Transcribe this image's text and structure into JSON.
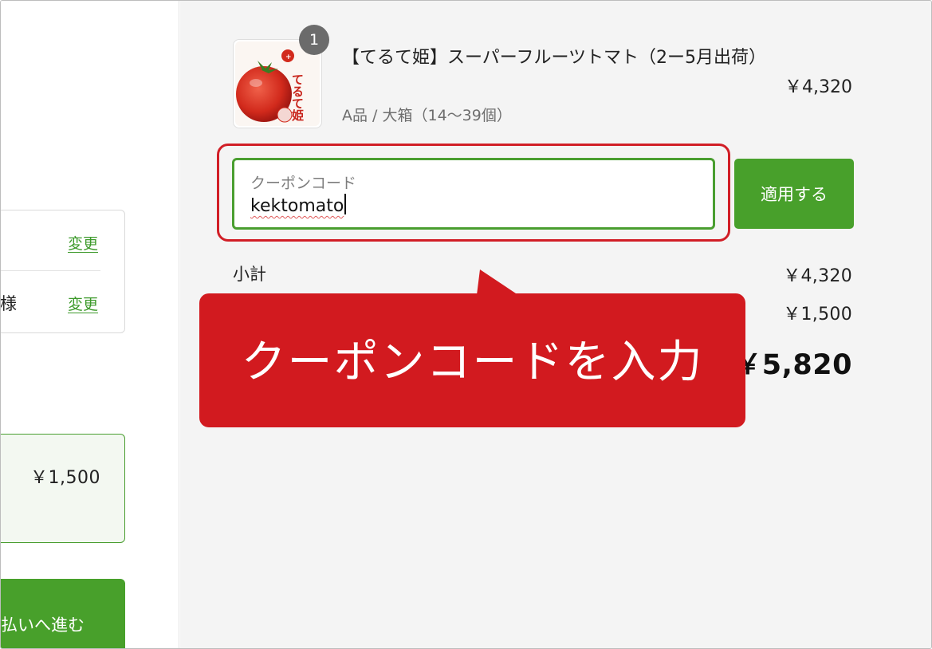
{
  "left": {
    "contact": {
      "change_label_1": "変更",
      "recipient_suffix": "様",
      "change_label_2": "変更"
    },
    "shipping": {
      "price": "￥1,500"
    },
    "proceed_button": "払いへ進む"
  },
  "cart": {
    "item": {
      "quantity": "1",
      "name": "【てるて姫】スーパーフルーツトマト（2ー5月出荷）",
      "variant": "A品 / 大箱（14〜39個）",
      "price": "￥4,320",
      "thumbnail_text": "てるて姫"
    },
    "coupon": {
      "label": "クーポンコード",
      "value": "kektomato",
      "apply_label": "適用する"
    },
    "summary": {
      "subtotal_label": "小計",
      "subtotal_value": "￥4,320",
      "shipping_value": "￥1,500",
      "total_value": "￥5,820"
    }
  },
  "annotation": {
    "callout_text": "クーポンコードを入力"
  },
  "colors": {
    "accent_green": "#48a02b",
    "callout_red": "#d21a1f",
    "right_panel_bg": "#f4f4f4"
  }
}
